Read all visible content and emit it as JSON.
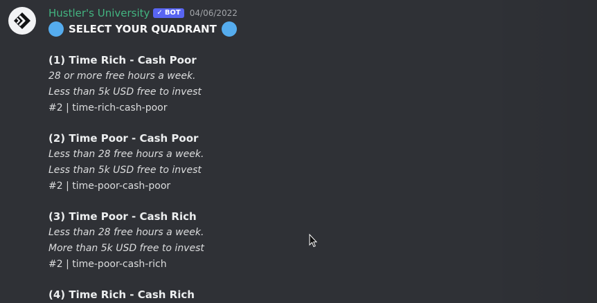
{
  "message": {
    "username": "Hustler's University",
    "bot_tag": "BOT",
    "bot_tag_check": "✓",
    "timestamp": "04/06/2022",
    "headline": "SELECT YOUR QUADRANT"
  },
  "quadrants": [
    {
      "title": "(1) Time Rich - Cash Poor",
      "line1": "28 or more free hours a week.",
      "line2": "Less than 5k USD free to invest",
      "channel": "#2 | time-rich-cash-poor"
    },
    {
      "title": "(2) Time Poor - Cash Poor",
      "line1": "Less than 28 free hours a week.",
      "line2": "Less than 5k USD free to invest",
      "channel": "#2 | time-poor-cash-poor"
    },
    {
      "title": "(3) Time Poor - Cash Rich",
      "line1": "Less than 28 free hours a week.",
      "line2": "More than 5k USD free to invest",
      "channel": "#2 | time-poor-cash-rich"
    },
    {
      "title": "(4) Time Rich - Cash Rich"
    }
  ],
  "colors": {
    "background": "#2f3136",
    "username": "#43b581",
    "bot_tag": "#5865f2",
    "circle_emoji": "#55acee"
  },
  "icons": {
    "avatar": "hustlers-university-logo",
    "headline_emoji": "blue-circle",
    "cursor": "mouse-pointer"
  }
}
